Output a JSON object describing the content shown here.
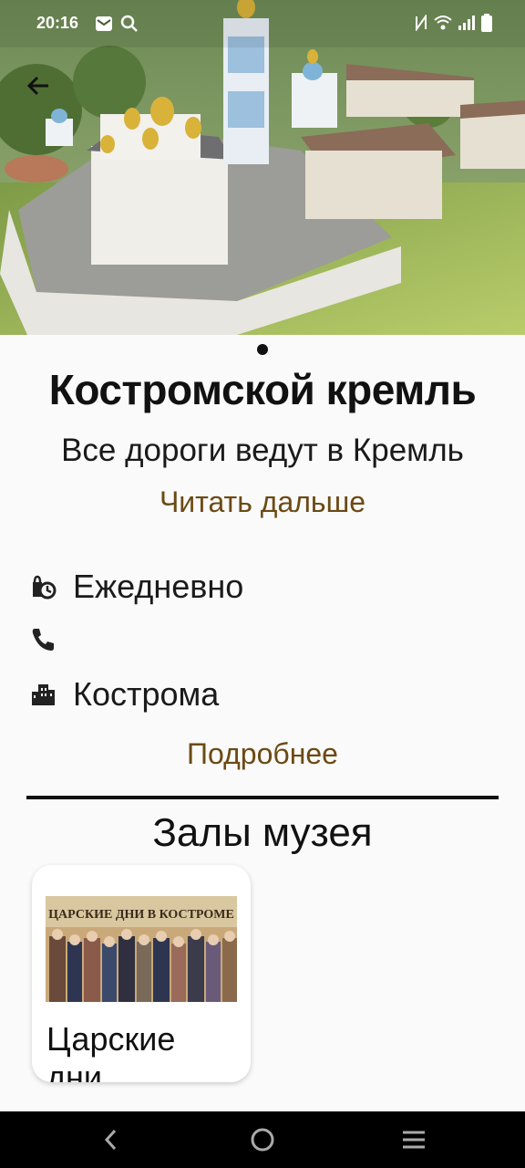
{
  "status_bar": {
    "time": "20:16",
    "icons": [
      "mail-icon",
      "search-icon",
      "nfc-icon",
      "wifi-icon",
      "signal-icon",
      "battery-icon"
    ]
  },
  "hero": {
    "image": "kostroma-kremlin-render",
    "page_indicator": "1"
  },
  "place": {
    "title": "Костромской кремль",
    "subtitle": "Все дороги ведут в Кремль",
    "read_more": "Читать дальше"
  },
  "info": {
    "schedule": "Ежедневно",
    "phone": "",
    "city": "Кострома",
    "details_link": "Подробнее"
  },
  "halls": {
    "section_title": "Залы музея",
    "items": [
      {
        "title": "Царские дни",
        "banner_text": "ЦАРСКИЕ ДНИ В КОСТРОМЕ"
      }
    ]
  },
  "colors": {
    "accent_link": "#6b4a14",
    "background": "#fafafa"
  }
}
